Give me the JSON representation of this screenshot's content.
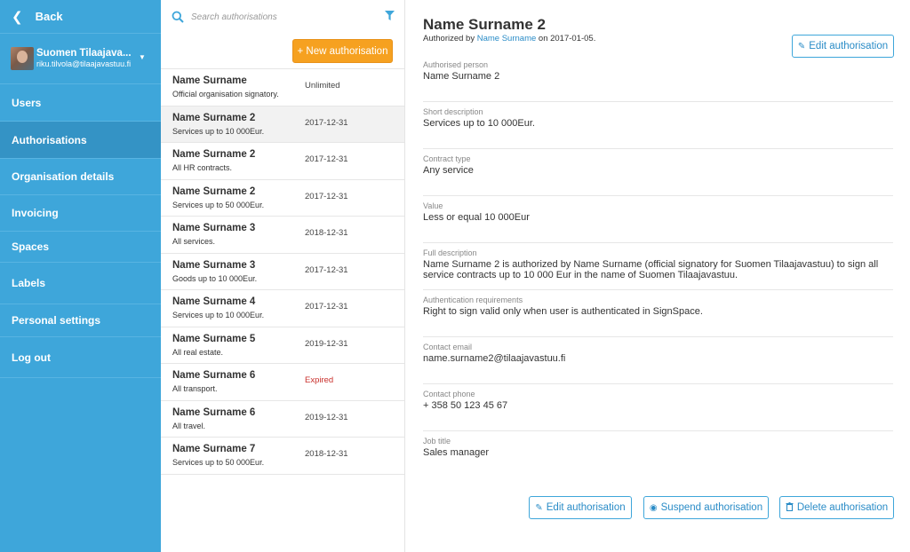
{
  "sidebar": {
    "back_label": "Back",
    "account_name": "Suomen Tilaajava...",
    "account_email": "riku.tilvola@tilaajavastuu.fi",
    "items": [
      {
        "label": "Users"
      },
      {
        "label": "Authorisations"
      },
      {
        "label": "Organisation details"
      },
      {
        "label": "Invoicing"
      },
      {
        "label": "Spaces"
      },
      {
        "label": "Labels"
      },
      {
        "label": "Personal settings"
      },
      {
        "label": "Log out"
      }
    ]
  },
  "list": {
    "search_placeholder": "Search authorisations",
    "new_button": "+ New authorisation",
    "rows": [
      {
        "name": "Name Surname",
        "desc": "Official organisation signatory.",
        "date": "Unlimited"
      },
      {
        "name": "Name Surname 2",
        "desc": "Services up to 10 000Eur.",
        "date": "2017-12-31"
      },
      {
        "name": "Name Surname 2",
        "desc": "All HR contracts.",
        "date": "2017-12-31"
      },
      {
        "name": "Name Surname 2",
        "desc": "Services up to 50 000Eur.",
        "date": "2017-12-31"
      },
      {
        "name": "Name Surname 3",
        "desc": "All services.",
        "date": "2018-12-31"
      },
      {
        "name": "Name Surname 3",
        "desc": "Goods up to 10 000Eur.",
        "date": "2017-12-31"
      },
      {
        "name": "Name Surname 4",
        "desc": "Services up to 10 000Eur.",
        "date": "2017-12-31"
      },
      {
        "name": "Name Surname 5",
        "desc": "All real estate.",
        "date": "2019-12-31"
      },
      {
        "name": "Name Surname 6",
        "desc": "All transport.",
        "date": "Expired"
      },
      {
        "name": "Name Surname 6",
        "desc": "All travel.",
        "date": "2019-12-31"
      },
      {
        "name": "Name Surname 7",
        "desc": "Services up to 50 000Eur.",
        "date": "2018-12-31"
      }
    ]
  },
  "detail": {
    "title": "Name Surname 2",
    "authorized_by_prefix": "Authorized by",
    "authorized_by_link": "Name Surname",
    "authorized_on": "on 2017-01-05.",
    "edit_top": "Edit authorisation",
    "fields": [
      {
        "label": "Authorised person",
        "value": "Name Surname 2"
      },
      {
        "label": "Short description",
        "value": "Services up to 10 000Eur."
      },
      {
        "label": "Contract type",
        "value": "Any service"
      },
      {
        "label": "Value",
        "value": "Less or equal 10 000Eur"
      },
      {
        "label": "Full description",
        "value": "Name Surname 2 is authorized by Name Surname (official signatory for Suomen Tilaajavastuu) to sign all service contracts up to 10 000 Eur in the name of Suomen Tilaajavastuu."
      },
      {
        "label": "Authentication requirements",
        "value": "Right to sign valid only when user is authenticated in SignSpace."
      },
      {
        "label": "Contact email",
        "value": "name.surname2@tilaajavastuu.fi"
      },
      {
        "label": "Contact phone",
        "value": "+ 358 50 123 45 67"
      },
      {
        "label": "Job title",
        "value": "Sales manager"
      }
    ],
    "buttons": {
      "edit": "Edit authorisation",
      "suspend": "Suspend authorisation",
      "delete": "Delete authorisation"
    }
  },
  "colors": {
    "sidebar": "#3ea6da",
    "sidebar_active": "#3493c5",
    "accent_orange": "#f6a120",
    "link_blue": "#2a8cc7",
    "expired_red": "#c9302c"
  }
}
